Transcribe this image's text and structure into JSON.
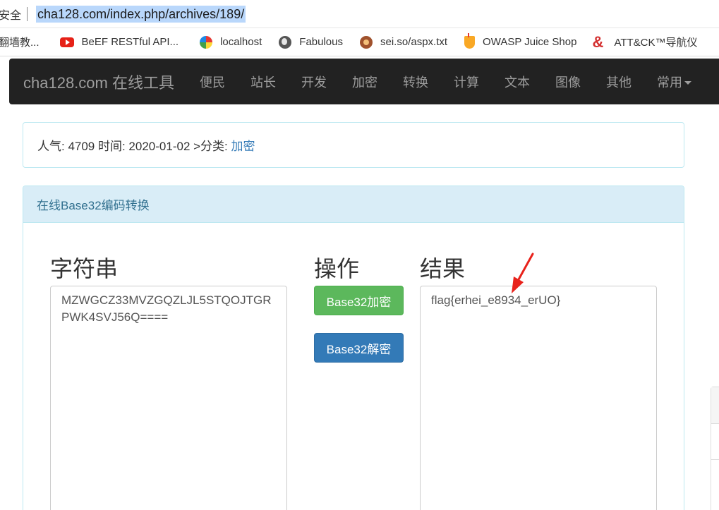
{
  "browser": {
    "security_text": "安全",
    "url": "cha128.com/index.php/archives/189/"
  },
  "bookmarks": [
    {
      "label": "翻墙教...",
      "icon": "none"
    },
    {
      "label": "BeEF RESTful API...",
      "icon": "youtube-icon"
    },
    {
      "label": "localhost",
      "icon": "colorful-logo-icon"
    },
    {
      "label": "Fabulous",
      "icon": "globe-icon"
    },
    {
      "label": "sei.so/aspx.txt",
      "icon": "sei-icon"
    },
    {
      "label": "OWASP Juice Shop",
      "icon": "juice-icon"
    },
    {
      "label": "ATT&CK™导航仪",
      "icon": "ampersand-icon"
    }
  ],
  "navbar": {
    "brand": "cha128.com 在线工具",
    "items": [
      "便民",
      "站长",
      "开发",
      "加密",
      "转换",
      "计算",
      "文本",
      "图像",
      "其他",
      "常用"
    ]
  },
  "info": {
    "text": "人气: 4709 时间: 2020-01-02 >分类: ",
    "category": "加密"
  },
  "tool": {
    "title": "在线Base32编码转换",
    "input_title": "字符串",
    "input_value": "MZWGCZ33MVZGQZLJL5STQOJTGRPWK4SVJ56Q====",
    "action_title": "操作",
    "encode_button": "Base32加密",
    "decode_button": "Base32解密",
    "result_title": "结果",
    "result_value": "flag{erhei_e8934_erUO}"
  },
  "colors": {
    "navbar_bg": "#222222",
    "encode_btn": "#5cb85c",
    "decode_btn": "#337ab7",
    "annotation": "#e8221b"
  }
}
